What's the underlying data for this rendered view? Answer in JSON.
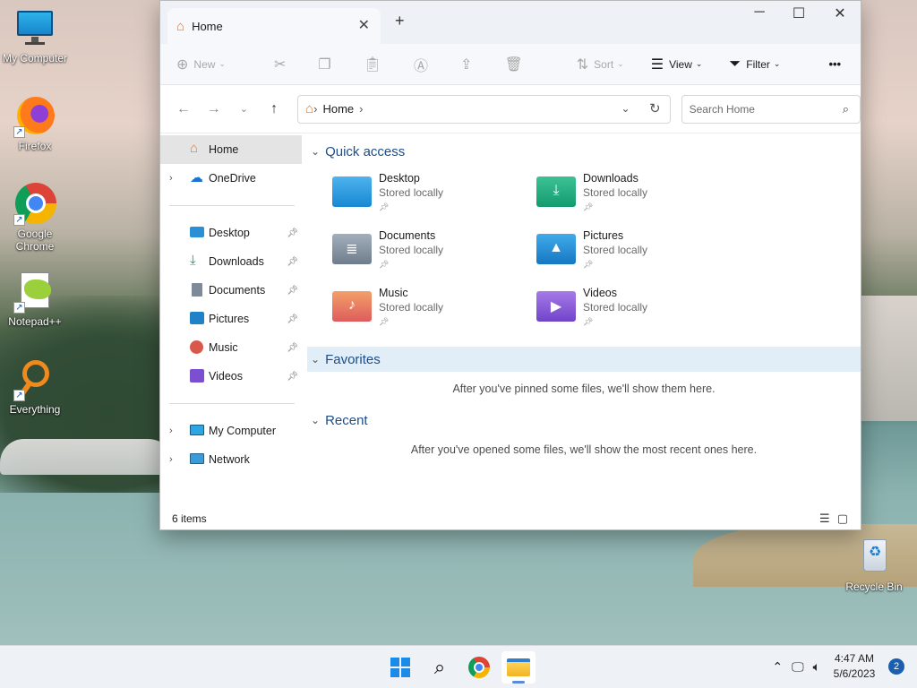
{
  "desktop": {
    "icons": [
      {
        "label": "My Computer",
        "icon": "monitor-icon"
      },
      {
        "label": "Firefox",
        "icon": "firefox-icon"
      },
      {
        "label": "Google Chrome",
        "icon": "chrome-icon"
      },
      {
        "label": "Notepad++",
        "icon": "notepadpp-icon"
      },
      {
        "label": "Everything",
        "icon": "everything-search-icon"
      },
      {
        "label": "Recycle Bin",
        "icon": "recycle-bin-icon"
      }
    ]
  },
  "window": {
    "tab_title": "Home",
    "tab_close": "✕",
    "new_tab": "+",
    "controls": {
      "minimize": "─",
      "maximize": "☐",
      "close": "✕"
    }
  },
  "toolbar": {
    "new_label": "New",
    "sort_label": "Sort",
    "view_label": "View",
    "filter_label": "Filter",
    "more_label": "•••"
  },
  "address": {
    "crumb": "Home",
    "search_placeholder": "Search Home"
  },
  "nav_pane": {
    "home": "Home",
    "onedrive": "OneDrive",
    "pinned": [
      {
        "label": "Desktop",
        "icon": "desktop-folder-icon",
        "color": "#2b8fd6"
      },
      {
        "label": "Downloads",
        "icon": "download-icon",
        "color": "#1a9a6c"
      },
      {
        "label": "Documents",
        "icon": "document-icon",
        "color": "#7d8a99"
      },
      {
        "label": "Pictures",
        "icon": "picture-icon",
        "color": "#1f82c9"
      },
      {
        "label": "Music",
        "icon": "music-icon",
        "color": "#d9584a"
      },
      {
        "label": "Videos",
        "icon": "video-icon",
        "color": "#7a4fd0"
      }
    ],
    "my_computer": "My Computer",
    "network": "Network"
  },
  "content": {
    "quick_access_title": "Quick access",
    "quick_access": [
      {
        "name": "Desktop",
        "sub": "Stored locally",
        "icon": "desktop-folder-icon",
        "color": "#2b9be0"
      },
      {
        "name": "Downloads",
        "sub": "Stored locally",
        "icon": "download-folder-icon",
        "color": "#1fa37a"
      },
      {
        "name": "Documents",
        "sub": "Stored locally",
        "icon": "documents-folder-icon",
        "color": "#7f8c9b"
      },
      {
        "name": "Pictures",
        "sub": "Stored locally",
        "icon": "pictures-folder-icon",
        "color": "#2494d8"
      },
      {
        "name": "Music",
        "sub": "Stored locally",
        "icon": "music-folder-icon",
        "color": "#e2685a"
      },
      {
        "name": "Videos",
        "sub": "Stored locally",
        "icon": "videos-folder-icon",
        "color": "#8550d8"
      }
    ],
    "favorites_title": "Favorites",
    "favorites_empty": "After you've pinned some files, we'll show them here.",
    "recent_title": "Recent",
    "recent_empty": "After you've opened some files, we'll show the most recent ones here."
  },
  "status": {
    "item_count": "6 items"
  },
  "taskbar": {
    "time": "4:47 AM",
    "date": "5/6/2023",
    "notifications": "2"
  }
}
